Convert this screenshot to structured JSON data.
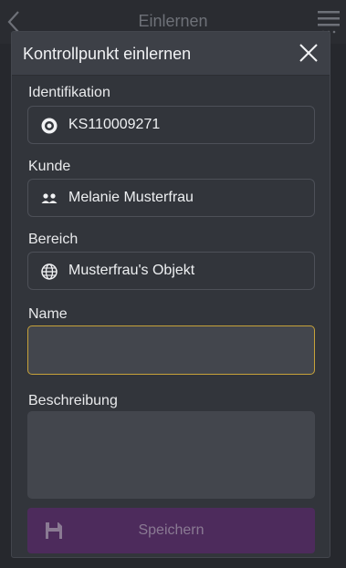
{
  "app_bar": {
    "title": "Einlernen",
    "back_icon": "chevron-left-icon",
    "menu_icon": "menu-icon"
  },
  "dialog": {
    "title": "Kontrollpunkt einlernen",
    "close_icon": "close-icon",
    "fields": {
      "identifikation": {
        "label": "Identifikation",
        "value": "KS110009271",
        "icon": "target-icon"
      },
      "kunde": {
        "label": "Kunde",
        "value": "Melanie Musterfrau",
        "icon": "users-icon"
      },
      "bereich": {
        "label": "Bereich",
        "value": "Musterfrau's Objekt",
        "icon": "globe-icon"
      }
    },
    "name": {
      "label": "Name",
      "value": ""
    },
    "beschreibung": {
      "label": "Beschreibung",
      "value": ""
    },
    "save": {
      "label": "Speichern",
      "icon": "save-icon"
    }
  },
  "colors": {
    "background": "#26282d",
    "dialog": "#32353b",
    "header": "#3d4047",
    "focus_border": "#c7a23a",
    "save_button": "#4d2b5c"
  }
}
